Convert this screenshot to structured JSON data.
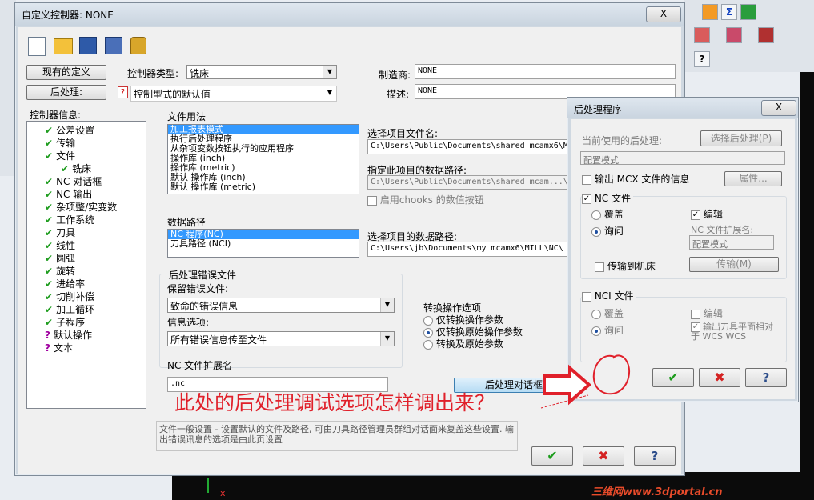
{
  "main_dialog": {
    "title": "自定义控制器: NONE",
    "close_label": "X",
    "btn_current_definition": "现有的定义",
    "btn_post": "后处理:",
    "label_controller_type": "控制器类型:",
    "controller_type": "铣床",
    "post_value": "控制型式的默认值",
    "label_manufacturer": "制造商:",
    "manufacturer": "NONE",
    "label_description": "描述:",
    "description": "NONE",
    "label_controller_info": "控制器信息:",
    "tree": [
      {
        "label": "公差设置",
        "icon": "check"
      },
      {
        "label": "传输",
        "icon": "check"
      },
      {
        "label": "文件",
        "icon": "check"
      },
      {
        "label": "铣床",
        "icon": "check"
      },
      {
        "label": "NC 对话框",
        "icon": "check"
      },
      {
        "label": "NC 输出",
        "icon": "check"
      },
      {
        "label": "杂项整/实变数",
        "icon": "check"
      },
      {
        "label": "工作系统",
        "icon": "check"
      },
      {
        "label": "刀具",
        "icon": "check"
      },
      {
        "label": "线性",
        "icon": "check"
      },
      {
        "label": "圆弧",
        "icon": "check"
      },
      {
        "label": "旋转",
        "icon": "check"
      },
      {
        "label": "进给率",
        "icon": "check"
      },
      {
        "label": "切削补偿",
        "icon": "check"
      },
      {
        "label": "加工循环",
        "icon": "check"
      },
      {
        "label": "子程序",
        "icon": "check"
      },
      {
        "label": "默认操作",
        "icon": "question"
      },
      {
        "label": "文本",
        "icon": "question"
      }
    ],
    "file_usage_label": "文件用法",
    "file_usage_items": [
      "加工报表模式",
      "执行后处理程序",
      "从杂项变数按钮执行的应用程序",
      "操作库 (inch)",
      "操作库 (metric)",
      "默认 操作库 (inch)",
      "默认 操作库 (metric)"
    ],
    "label_select_file": "选择项目文件名:",
    "select_file_path": "C:\\Users\\Public\\Documents\\shared mcamx6\\M",
    "label_specify_data_path": "指定此项目的数据路径:",
    "specify_data_path": "C:\\Users\\Public\\Documents\\shared mcam...\\",
    "chk_chooks": "启用chooks 的数值按钮",
    "data_path_label": "数据路径",
    "data_path_items": [
      "NC 程序(NC)",
      "刀具路径 (NCI)"
    ],
    "label_select_data_path": "选择项目的数据路径:",
    "select_data_path": "C:\\Users\\jb\\Documents\\my mcamx6\\MILL\\NC\\",
    "error_file_group": "后处理错误文件",
    "label_keep_error": "保留错误文件:",
    "keep_error_value": "致命的错误信息",
    "label_info_option": "信息选项:",
    "info_option_value": "所有错误信息传至文件",
    "convert_group": "转换操作选项",
    "convert_options": [
      "仅转换操作参数",
      "仅转换原始操作参数",
      "转换及原始参数"
    ],
    "nc_ext_label": "NC 文件扩展名",
    "nc_ext_value": ".nc",
    "btn_post_dialog": "后处理对话框",
    "status_text": "文件一般设置 - 设置默认的文件及路径, 可由刀具路径管理员群组对话面来复盖这些设置. 输出错误讯息的选项是由此页设置"
  },
  "post_dialog": {
    "title": "后处理程序",
    "close_label": "X",
    "label_current_post": "当前使用的后处理:",
    "btn_select_post": "选择后处理(P)",
    "current_post_value": "配置模式",
    "chk_output_mcx": "输出 MCX 文件的信息",
    "btn_properties": "属性...",
    "nc_group_title": "NC 文件",
    "nc_overwrite": "覆盖",
    "nc_ask": "询问",
    "nc_edit": "编辑",
    "nc_ext_label": "NC 文件扩展名:",
    "nc_ext_value": "配置模式",
    "chk_send_machine": "传输到机床",
    "btn_send": "传输(M)",
    "nci_group_title": "NCI 文件",
    "nci_overwrite": "覆盖",
    "nci_ask": "询问",
    "nci_edit": "编辑",
    "nci_output_tool": "输出刀具平面相对于 WCS WCS"
  },
  "annotation": {
    "question": "此处的后处理调试选项怎样调出来？"
  },
  "watermark": "三维网www.3dportal.cn",
  "colors": {
    "annotation_red": "#e0202a",
    "green_check": "#1d9c1d",
    "selection_blue": "#3399ff"
  }
}
